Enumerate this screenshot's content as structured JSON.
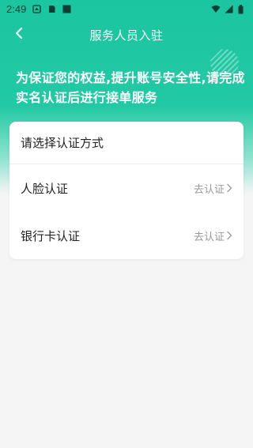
{
  "status_bar": {
    "time": "2:49",
    "icons": [
      "notification-icon",
      "sim-icon",
      "app-icon",
      "wifi-icon",
      "signal-icon",
      "battery-icon"
    ]
  },
  "header": {
    "title": "服务人员入驻",
    "back_icon": "chevron-left-icon"
  },
  "notice": {
    "text": "为保证您的权益,提升账号安全性,请完成实名认证后进行接单服务"
  },
  "card": {
    "title": "请选择认证方式",
    "options": [
      {
        "label": "人脸认证",
        "action": "去认证",
        "icon": "chevron-right-icon"
      },
      {
        "label": "银行卡认证",
        "action": "去认证",
        "icon": "chevron-right-icon"
      }
    ]
  },
  "colors": {
    "accent": "#1bc5a0",
    "background": "#f5f5f5",
    "card": "#ffffff",
    "muted_text": "#999999"
  }
}
